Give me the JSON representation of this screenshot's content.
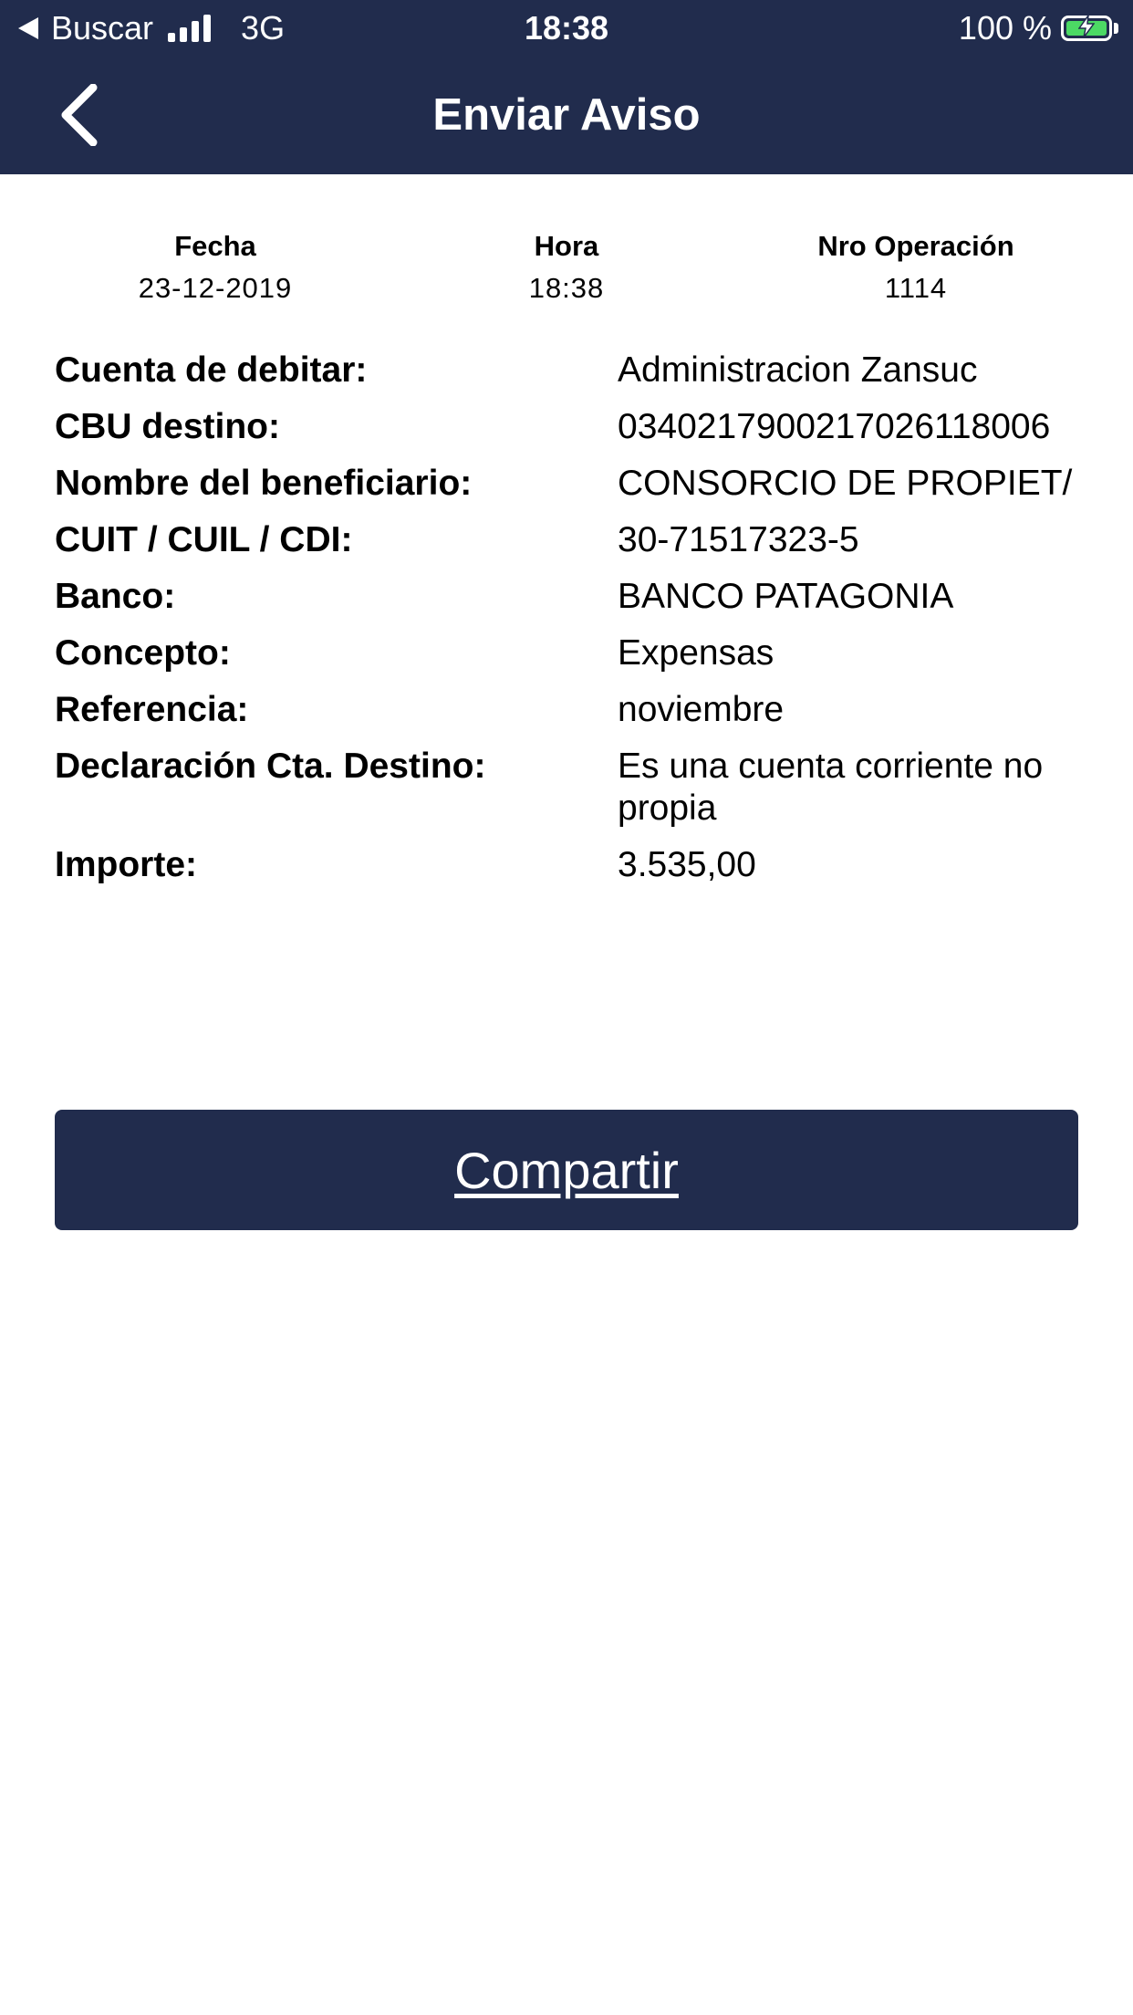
{
  "status_bar": {
    "back_app_label": "Buscar",
    "network": "3G",
    "time": "18:38",
    "battery": "100 %",
    "battery_color": "#4cd964"
  },
  "header": {
    "title": "Enviar Aviso",
    "back_icon": "chevron-left-icon",
    "background_color": "#212c4d"
  },
  "meta": {
    "fecha_label": "Fecha",
    "fecha_value": "23-12-2019",
    "hora_label": "Hora",
    "hora_value": "18:38",
    "operacion_label": "Nro Operación",
    "operacion_value": "1114"
  },
  "details": [
    {
      "label": "Cuenta de debitar:",
      "value": "Administracion Zansuc"
    },
    {
      "label": "CBU destino:",
      "value": "0340217900217026118006"
    },
    {
      "label": "Nombre del beneficiario:",
      "value": "CONSORCIO DE PROPIET/"
    },
    {
      "label": "CUIT / CUIL / CDI:",
      "value": "30-71517323-5"
    },
    {
      "label": "Banco:",
      "value": "BANCO PATAGONIA"
    },
    {
      "label": "Concepto:",
      "value": "Expensas"
    },
    {
      "label": "Referencia:",
      "value": "noviembre"
    },
    {
      "label": "Declaración Cta. Destino:",
      "value": "Es una cuenta corriente no propia"
    },
    {
      "label": "Importe:",
      "value": "3.535,00"
    }
  ],
  "actions": {
    "share_label": "Compartir"
  }
}
